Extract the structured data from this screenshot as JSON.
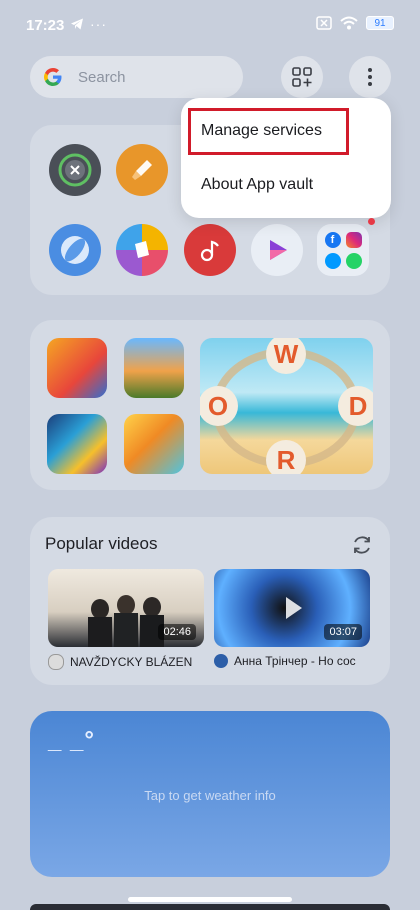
{
  "status": {
    "time": "17:23",
    "battery": "91"
  },
  "search": {
    "placeholder": "Search"
  },
  "menu": {
    "items": [
      "Manage services",
      "About App vault"
    ]
  },
  "videos": {
    "title": "Popular videos",
    "items": [
      {
        "title": "NAVŽDYCKY BLÁZEN",
        "duration": "02:46"
      },
      {
        "title": "Анна Трінчер - Но сос",
        "duration": "03:07"
      }
    ]
  },
  "weather": {
    "text": "Tap to get weather info",
    "placeholder": "_ _°"
  },
  "colors": {
    "accent_red": "#d11b2a",
    "weather_blue": "#4b86d4"
  }
}
